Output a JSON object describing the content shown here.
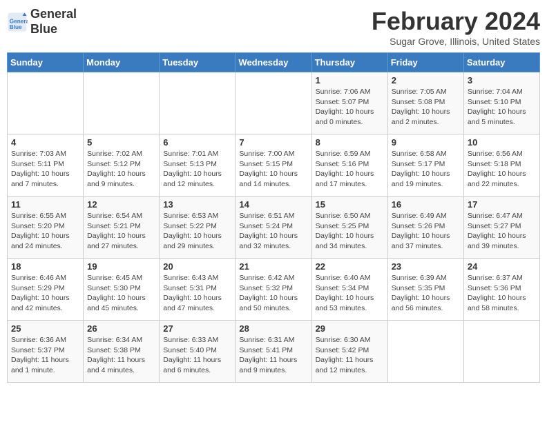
{
  "header": {
    "logo_line1": "General",
    "logo_line2": "Blue",
    "month_title": "February 2024",
    "location": "Sugar Grove, Illinois, United States"
  },
  "days_of_week": [
    "Sunday",
    "Monday",
    "Tuesday",
    "Wednesday",
    "Thursday",
    "Friday",
    "Saturday"
  ],
  "weeks": [
    [
      {
        "day": "",
        "info": ""
      },
      {
        "day": "",
        "info": ""
      },
      {
        "day": "",
        "info": ""
      },
      {
        "day": "",
        "info": ""
      },
      {
        "day": "1",
        "info": "Sunrise: 7:06 AM\nSunset: 5:07 PM\nDaylight: 10 hours\nand 0 minutes."
      },
      {
        "day": "2",
        "info": "Sunrise: 7:05 AM\nSunset: 5:08 PM\nDaylight: 10 hours\nand 2 minutes."
      },
      {
        "day": "3",
        "info": "Sunrise: 7:04 AM\nSunset: 5:10 PM\nDaylight: 10 hours\nand 5 minutes."
      }
    ],
    [
      {
        "day": "4",
        "info": "Sunrise: 7:03 AM\nSunset: 5:11 PM\nDaylight: 10 hours\nand 7 minutes."
      },
      {
        "day": "5",
        "info": "Sunrise: 7:02 AM\nSunset: 5:12 PM\nDaylight: 10 hours\nand 9 minutes."
      },
      {
        "day": "6",
        "info": "Sunrise: 7:01 AM\nSunset: 5:13 PM\nDaylight: 10 hours\nand 12 minutes."
      },
      {
        "day": "7",
        "info": "Sunrise: 7:00 AM\nSunset: 5:15 PM\nDaylight: 10 hours\nand 14 minutes."
      },
      {
        "day": "8",
        "info": "Sunrise: 6:59 AM\nSunset: 5:16 PM\nDaylight: 10 hours\nand 17 minutes."
      },
      {
        "day": "9",
        "info": "Sunrise: 6:58 AM\nSunset: 5:17 PM\nDaylight: 10 hours\nand 19 minutes."
      },
      {
        "day": "10",
        "info": "Sunrise: 6:56 AM\nSunset: 5:18 PM\nDaylight: 10 hours\nand 22 minutes."
      }
    ],
    [
      {
        "day": "11",
        "info": "Sunrise: 6:55 AM\nSunset: 5:20 PM\nDaylight: 10 hours\nand 24 minutes."
      },
      {
        "day": "12",
        "info": "Sunrise: 6:54 AM\nSunset: 5:21 PM\nDaylight: 10 hours\nand 27 minutes."
      },
      {
        "day": "13",
        "info": "Sunrise: 6:53 AM\nSunset: 5:22 PM\nDaylight: 10 hours\nand 29 minutes."
      },
      {
        "day": "14",
        "info": "Sunrise: 6:51 AM\nSunset: 5:24 PM\nDaylight: 10 hours\nand 32 minutes."
      },
      {
        "day": "15",
        "info": "Sunrise: 6:50 AM\nSunset: 5:25 PM\nDaylight: 10 hours\nand 34 minutes."
      },
      {
        "day": "16",
        "info": "Sunrise: 6:49 AM\nSunset: 5:26 PM\nDaylight: 10 hours\nand 37 minutes."
      },
      {
        "day": "17",
        "info": "Sunrise: 6:47 AM\nSunset: 5:27 PM\nDaylight: 10 hours\nand 39 minutes."
      }
    ],
    [
      {
        "day": "18",
        "info": "Sunrise: 6:46 AM\nSunset: 5:29 PM\nDaylight: 10 hours\nand 42 minutes."
      },
      {
        "day": "19",
        "info": "Sunrise: 6:45 AM\nSunset: 5:30 PM\nDaylight: 10 hours\nand 45 minutes."
      },
      {
        "day": "20",
        "info": "Sunrise: 6:43 AM\nSunset: 5:31 PM\nDaylight: 10 hours\nand 47 minutes."
      },
      {
        "day": "21",
        "info": "Sunrise: 6:42 AM\nSunset: 5:32 PM\nDaylight: 10 hours\nand 50 minutes."
      },
      {
        "day": "22",
        "info": "Sunrise: 6:40 AM\nSunset: 5:34 PM\nDaylight: 10 hours\nand 53 minutes."
      },
      {
        "day": "23",
        "info": "Sunrise: 6:39 AM\nSunset: 5:35 PM\nDaylight: 10 hours\nand 56 minutes."
      },
      {
        "day": "24",
        "info": "Sunrise: 6:37 AM\nSunset: 5:36 PM\nDaylight: 10 hours\nand 58 minutes."
      }
    ],
    [
      {
        "day": "25",
        "info": "Sunrise: 6:36 AM\nSunset: 5:37 PM\nDaylight: 11 hours\nand 1 minute."
      },
      {
        "day": "26",
        "info": "Sunrise: 6:34 AM\nSunset: 5:38 PM\nDaylight: 11 hours\nand 4 minutes."
      },
      {
        "day": "27",
        "info": "Sunrise: 6:33 AM\nSunset: 5:40 PM\nDaylight: 11 hours\nand 6 minutes."
      },
      {
        "day": "28",
        "info": "Sunrise: 6:31 AM\nSunset: 5:41 PM\nDaylight: 11 hours\nand 9 minutes."
      },
      {
        "day": "29",
        "info": "Sunrise: 6:30 AM\nSunset: 5:42 PM\nDaylight: 11 hours\nand 12 minutes."
      },
      {
        "day": "",
        "info": ""
      },
      {
        "day": "",
        "info": ""
      }
    ]
  ]
}
